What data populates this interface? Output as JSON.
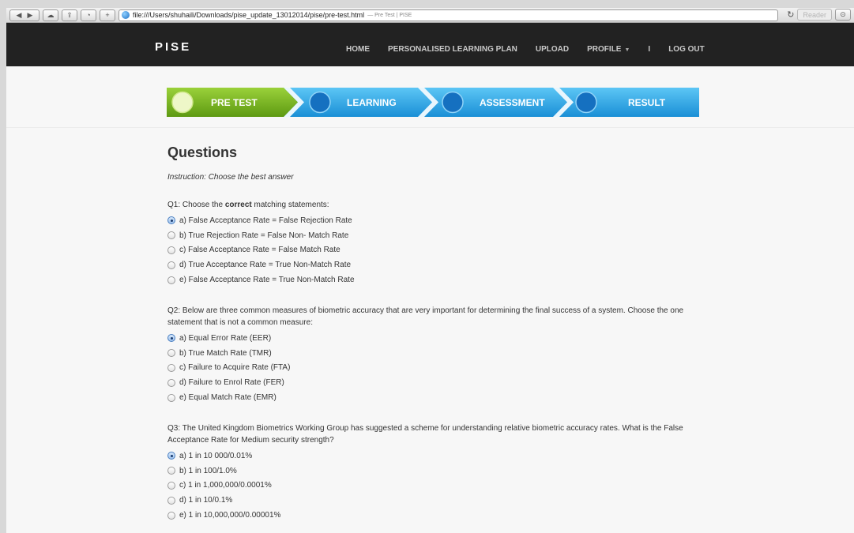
{
  "browser": {
    "url": "file:///Users/shuhaili/Downloads/pise_update_13012014/pise/pre-test.html",
    "page_title": "— Pre Test | PISE",
    "reader_label": "Reader"
  },
  "nav": {
    "brand": "PISE",
    "links": [
      "HOME",
      "PERSONALISED LEARNING PLAN",
      "UPLOAD",
      "PROFILE",
      "I",
      "LOG OUT"
    ]
  },
  "steps": [
    {
      "label": "PRE TEST",
      "active": true
    },
    {
      "label": "LEARNING",
      "active": false
    },
    {
      "label": "ASSESSMENT",
      "active": false
    },
    {
      "label": "RESULT",
      "active": false
    }
  ],
  "colors": {
    "active_step": "#7cba1c",
    "inactive_step": "#2ea6e8",
    "navbar": "#222222"
  },
  "content": {
    "title": "Questions",
    "instruction": "Instruction: Choose the best answer",
    "questions": [
      {
        "prefix": "Q1: Choose the ",
        "bold": "correct",
        "suffix": " matching statements:",
        "selected": 0,
        "options": [
          "a) False Acceptance Rate = False Rejection Rate",
          "b) True Rejection Rate = False Non- Match Rate",
          "c) False Acceptance Rate = False Match Rate",
          "d) True Acceptance Rate = True Non-Match Rate",
          "e) False Acceptance Rate = True Non-Match Rate"
        ]
      },
      {
        "text": "Q2: Below are three common measures of biometric accuracy that are very important for determining the final success of a system. Choose the one statement that is not a common measure:",
        "selected": 0,
        "options": [
          "a) Equal Error Rate (EER)",
          "b) True Match Rate (TMR)",
          "c) Failure to Acquire Rate (FTA)",
          "d) Failure to Enrol Rate (FER)",
          "e) Equal Match Rate (EMR)"
        ]
      },
      {
        "text": "Q3: The United Kingdom Biometrics Working Group has suggested a scheme for understanding relative biometric accuracy rates. What is the False Acceptance Rate for Medium security strength?",
        "selected": 0,
        "options": [
          "a) 1 in 10 000/0.01%",
          "b) 1 in 100/1.0%",
          "c) 1 in 1,000,000/0.0001%",
          "d) 1 in 10/0.1%",
          "e) 1 in 10,000,000/0.00001%"
        ]
      }
    ]
  }
}
